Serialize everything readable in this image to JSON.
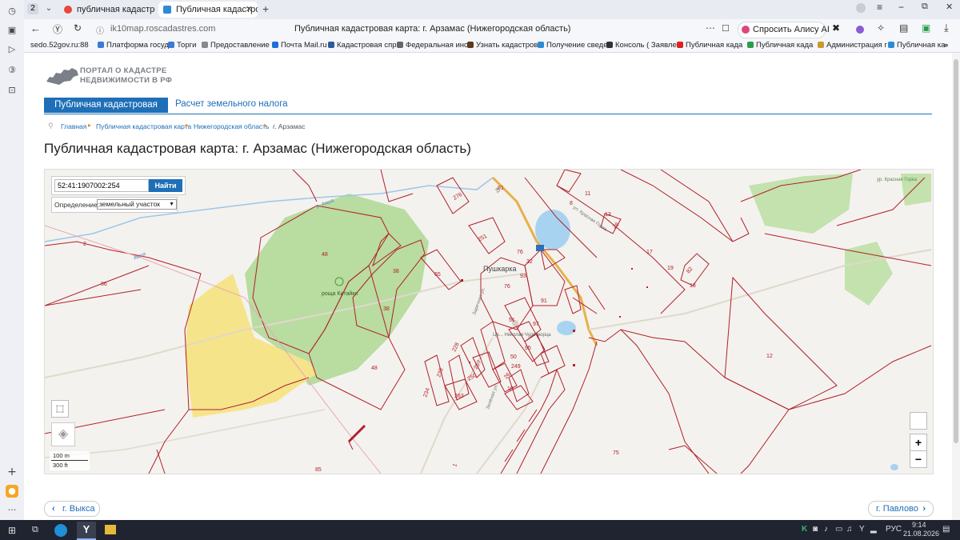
{
  "browser": {
    "tab_count": "2",
    "tabs": [
      {
        "title": "публичная кадастровая к"
      },
      {
        "title": "Публичная кадастрова"
      }
    ],
    "url": "ik10map.roscadastres.com",
    "page_title": "Публичная кадастровая карта: г. Арзамас (Нижегородская область)",
    "alice_label": "Спросить Алису AI",
    "bookmarks": [
      "sedo.52gov.ru:88",
      "Платформа госуд",
      "Торги",
      "Предоставление",
      "Почта Mail.ru",
      "Кадастровая спр",
      "Федеральная инс",
      "Узнать кадастров",
      "Получение сведе",
      "Консоль ( Заявле",
      "Публичная када",
      "Публичная када",
      "Администрация г",
      "Публичная ка"
    ]
  },
  "portal": {
    "logo_line1": "ПОРТАЛ О КАДАСТРЕ",
    "logo_line2": "НЕДВИЖИМОСТИ В РФ",
    "nav_active": "Публичная кадастровая карта",
    "nav_other": "Расчет земельного налога",
    "breadcrumbs": [
      "Главная",
      "Публичная кадастровая карта",
      "Нижегородская область",
      "г. Арзамас"
    ],
    "heading": "Публичная кадастровая карта: г. Арзамас (Нижегородская область)"
  },
  "map": {
    "search_value": "52:41:1907002:254",
    "search_button": "Найти",
    "definition_label": "Определение:",
    "definition_value": "земельный участок",
    "scale_m": "100 m",
    "scale_ft": "300 ft",
    "zoom_in": "+",
    "zoom_out": "−",
    "place_labels": {
      "village": "Пушкарка",
      "grove": "роща Китайки",
      "river": "р. Акша",
      "river2": "Акша",
      "street1": "ул. Красная Горка",
      "street2": "Заречная ул.",
      "street3": "Зелёная ул.",
      "church": "Це... Николая Чудотворца",
      "top_right": "ур. Красная Горка",
      "road": "81"
    },
    "parcel_numbers": [
      "48",
      "38",
      "38",
      "86",
      "85",
      "48",
      "276",
      "251",
      "65",
      "76",
      "93",
      "91",
      "51",
      "97",
      "95",
      "50",
      "32",
      "249",
      "228",
      "257",
      "235",
      "234",
      "250",
      "263",
      "26",
      "10",
      "8",
      "11",
      "13",
      "17",
      "19",
      "26",
      "18",
      "12",
      "75",
      "76",
      "81",
      "82",
      "1",
      "2"
    ]
  },
  "footer_nav": {
    "prev": "г. Выкса",
    "next": "г. Павлово"
  },
  "taskbar": {
    "time": "9:14",
    "date": "21.08.2026",
    "lang": "РУС"
  },
  "colors": {
    "accent": "#1e6fb8",
    "parcel_border": "#b0202a",
    "forest": "#b9dca0",
    "yellow_zone": "#f5e48a",
    "water": "#9fd0f2"
  }
}
